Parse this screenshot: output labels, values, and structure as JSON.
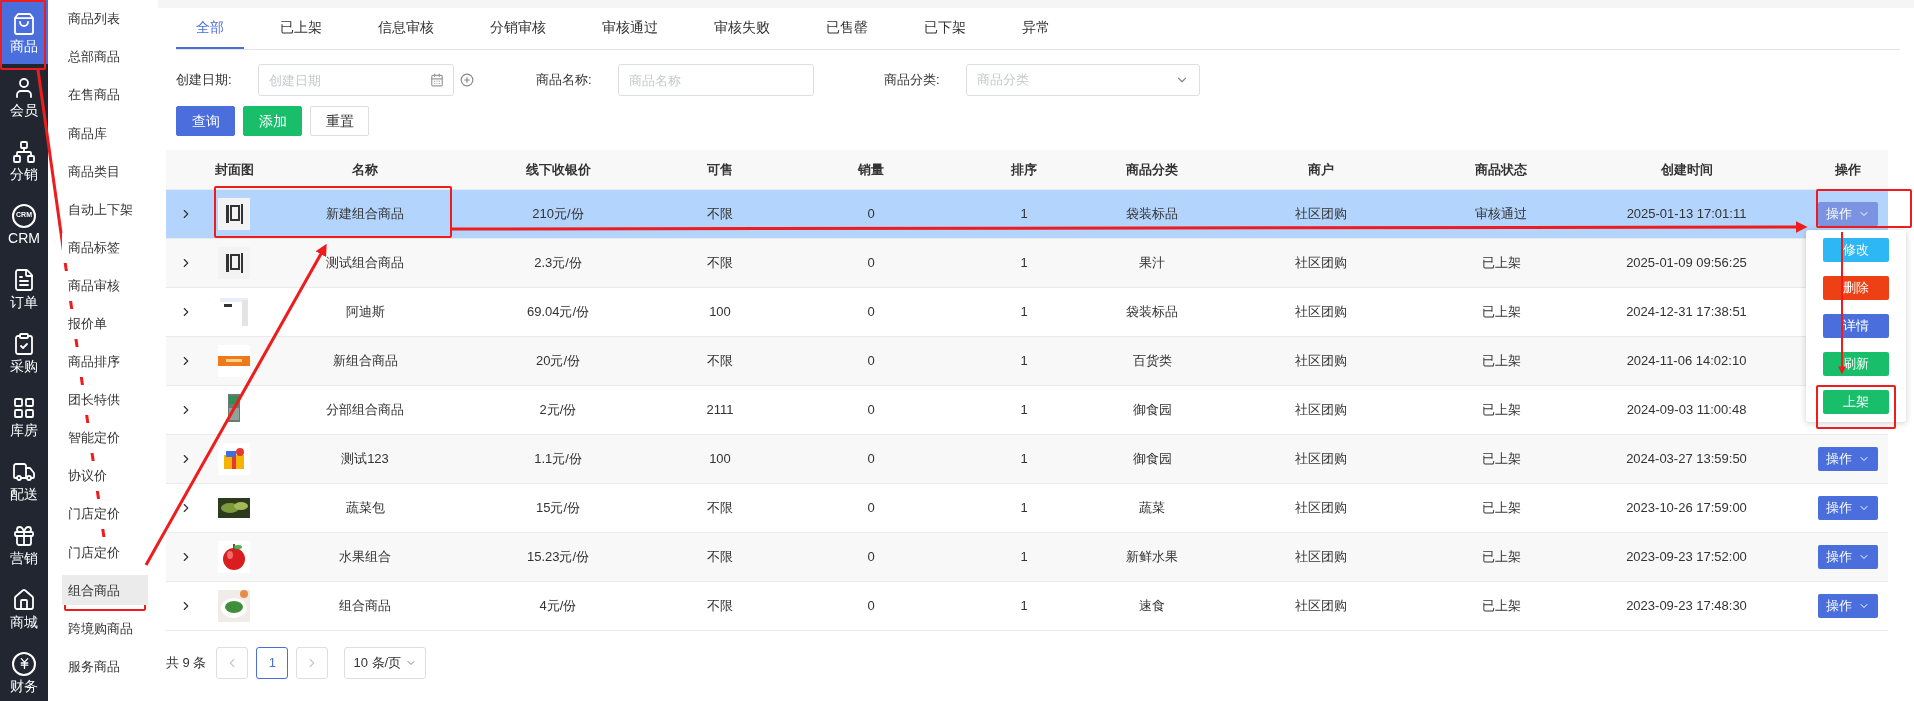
{
  "nav": [
    {
      "label": "商品",
      "selected": true
    },
    {
      "label": "会员",
      "selected": false
    },
    {
      "label": "分销",
      "selected": false
    },
    {
      "label": "CRM",
      "icon_text": "CRM",
      "selected": false
    },
    {
      "label": "订单",
      "selected": false
    },
    {
      "label": "采购",
      "selected": false
    },
    {
      "label": "库房",
      "selected": false
    },
    {
      "label": "配送",
      "selected": false
    },
    {
      "label": "营销",
      "selected": false
    },
    {
      "label": "商城",
      "selected": false
    },
    {
      "label": "财务",
      "selected": false
    }
  ],
  "submenu": [
    {
      "label": "商品列表",
      "selected": false
    },
    {
      "label": "总部商品",
      "selected": false
    },
    {
      "label": "在售商品",
      "selected": false
    },
    {
      "label": "商品库",
      "selected": false
    },
    {
      "label": "商品类目",
      "selected": false
    },
    {
      "label": "自动上下架",
      "selected": false
    },
    {
      "label": "商品标签",
      "selected": false
    },
    {
      "label": "商品审核",
      "selected": false
    },
    {
      "label": "报价单",
      "selected": false
    },
    {
      "label": "商品排序",
      "selected": false
    },
    {
      "label": "团长特供",
      "selected": false
    },
    {
      "label": "智能定价",
      "selected": false
    },
    {
      "label": "协议价",
      "selected": false
    },
    {
      "label": "门店定价",
      "selected": false
    },
    {
      "label": "门店定价",
      "selected": false
    },
    {
      "label": "组合商品",
      "selected": true
    },
    {
      "label": "跨境购商品",
      "selected": false
    },
    {
      "label": "服务商品",
      "selected": false
    }
  ],
  "tabs": [
    {
      "label": "全部",
      "selected": true
    },
    {
      "label": "已上架",
      "selected": false
    },
    {
      "label": "信息审核",
      "selected": false
    },
    {
      "label": "分销审核",
      "selected": false
    },
    {
      "label": "审核通过",
      "selected": false
    },
    {
      "label": "审核失败",
      "selected": false
    },
    {
      "label": "已售罄",
      "selected": false
    },
    {
      "label": "已下架",
      "selected": false
    },
    {
      "label": "异常",
      "selected": false
    }
  ],
  "filters": [
    {
      "kind": "date",
      "label": "创建日期:",
      "placeholder": "创建日期"
    },
    {
      "kind": "text",
      "label": "商品名称:",
      "placeholder": "商品名称"
    },
    {
      "kind": "select",
      "label": "商品分类:",
      "placeholder": "商品分类"
    }
  ],
  "buttons": [
    {
      "kind": "primary",
      "label": "查询"
    },
    {
      "kind": "success",
      "label": "添加"
    },
    {
      "kind": "default",
      "label": "重置"
    }
  ],
  "table": {
    "columns": [
      "封面图",
      "名称",
      "线下收银价",
      "可售",
      "销量",
      "排序",
      "商品分类",
      "商户",
      "商品状态",
      "创建时间",
      "操作"
    ],
    "rows": [
      {
        "selected": true,
        "expanded": false,
        "cells": [
          "",
          "新建组合商品",
          "210元/份",
          "不限",
          "0",
          "1",
          "袋装标品",
          "社区团购",
          "审核通过",
          "2025-01-13 17:01:11"
        ],
        "action": "操作"
      },
      {
        "selected": false,
        "expanded": false,
        "cells": [
          "",
          "测试组合商品",
          "2.3元/份",
          "不限",
          "0",
          "1",
          "果汁",
          "社区团购",
          "已上架",
          "2025-01-09 09:56:25"
        ]
      },
      {
        "selected": false,
        "expanded": false,
        "cells": [
          "",
          "阿迪斯",
          "69.04元/份",
          "100",
          "0",
          "1",
          "袋装标品",
          "社区团购",
          "已上架",
          "2024-12-31 17:38:51"
        ]
      },
      {
        "selected": false,
        "expanded": false,
        "cells": [
          "",
          "新组合商品",
          "20元/份",
          "不限",
          "0",
          "1",
          "百货类",
          "社区团购",
          "已上架",
          "2024-11-06 14:02:10"
        ]
      },
      {
        "selected": false,
        "expanded": false,
        "cells": [
          "",
          "分部组合商品",
          "2元/份",
          "2111",
          "0",
          "1",
          "御食园",
          "社区团购",
          "已上架",
          "2024-09-03 11:00:48"
        ]
      },
      {
        "selected": false,
        "expanded": false,
        "cells": [
          "",
          "测试123",
          "1.1元/份",
          "100",
          "0",
          "1",
          "御食园",
          "社区团购",
          "已上架",
          "2024-03-27 13:59:50"
        ],
        "action": "操作"
      },
      {
        "selected": false,
        "expanded": false,
        "cells": [
          "",
          "蔬菜包",
          "15元/份",
          "不限",
          "0",
          "1",
          "蔬菜",
          "社区团购",
          "已上架",
          "2023-10-26 17:59:00"
        ],
        "action": "操作"
      },
      {
        "selected": false,
        "expanded": false,
        "cells": [
          "",
          "水果组合",
          "15.23元/份",
          "不限",
          "0",
          "1",
          "新鲜水果",
          "社区团购",
          "已上架",
          "2023-09-23 17:52:00"
        ],
        "action": "操作"
      },
      {
        "selected": false,
        "expanded": false,
        "cells": [
          "",
          "组合商品",
          "4元/份",
          "不限",
          "0",
          "1",
          "速食",
          "社区团购",
          "已上架",
          "2023-09-23 17:48:30"
        ],
        "action": "操作"
      }
    ]
  },
  "action_menu": [
    {
      "label": "修改",
      "color": "#2db7f5"
    },
    {
      "label": "删除",
      "color": "#ed4014"
    },
    {
      "label": "详情",
      "color": "#4a6fdc"
    },
    {
      "label": "刷新",
      "color": "#19be6b"
    },
    {
      "label": "上架",
      "color": "#19be6b"
    }
  ],
  "pagination": {
    "total": "共 9 条",
    "pages": [
      {
        "label": "1",
        "selected": true
      }
    ],
    "page_size": "10 条/页"
  }
}
